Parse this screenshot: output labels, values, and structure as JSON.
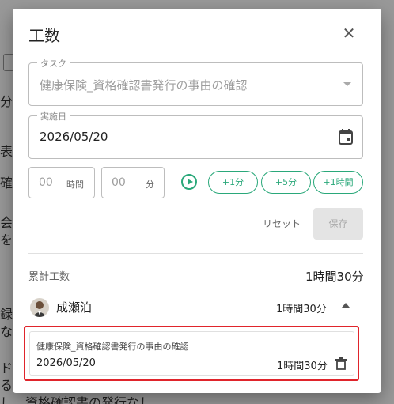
{
  "background": {
    "snippets": [
      "分",
      "表",
      "確",
      "会",
      "を",
      "録",
      "な",
      "ド",
      "る",
      "し、資格確認書の発行なし"
    ]
  },
  "dialog": {
    "title": "工数",
    "close_icon": "close-icon",
    "task_field": {
      "legend": "タスク",
      "value": "健康保険_資格確認書発行の事由の確認"
    },
    "date_field": {
      "legend": "実施日",
      "value": "2026/05/20",
      "icon": "calendar-icon"
    },
    "hours_input": {
      "value": "00",
      "unit": "時間"
    },
    "minutes_input": {
      "value": "00",
      "unit": "分"
    },
    "timer_icon": "play-icon",
    "quick_add": [
      "+1分",
      "+5分",
      "+1時間"
    ],
    "reset_label": "リセット",
    "save_label": "保存",
    "cumulative": {
      "label": "累計工数",
      "value": "1時間30分"
    },
    "user": {
      "name": "成瀬泊",
      "total": "1時間30分"
    },
    "entry": {
      "task": "健康保険_資格確認書発行の事由の確認",
      "date": "2026/05/20",
      "duration": "1時間30分"
    }
  },
  "colors": {
    "accent": "#2aa87a",
    "highlight": "#e0242b",
    "overlay": "rgba(0,0,0,0.40)"
  }
}
